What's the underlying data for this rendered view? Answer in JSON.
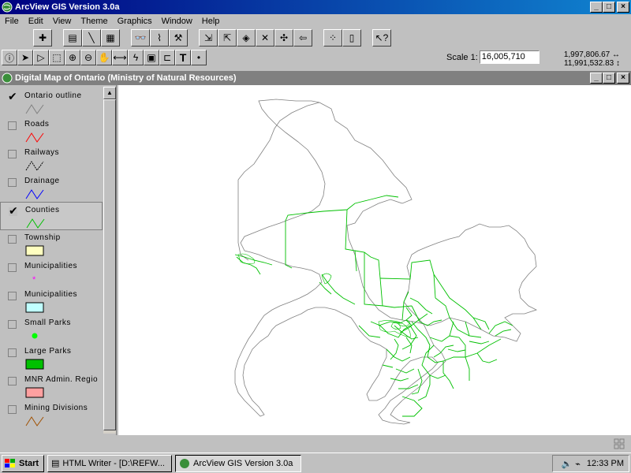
{
  "app": {
    "title": "ArcView GIS Version 3.0a"
  },
  "menu": [
    "File",
    "Edit",
    "View",
    "Theme",
    "Graphics",
    "Window",
    "Help"
  ],
  "toolbar": {
    "scale_label": "Scale 1:",
    "scale_value": "16,005,710",
    "coord_x": "1,997,806.67",
    "coord_y": "11,991,532.83"
  },
  "view": {
    "title": "Digital Map of Ontario (Ministry of Natural Resources)",
    "themes": [
      {
        "label": "Ontario outline",
        "checked": true,
        "legend": "line",
        "color": "#808080"
      },
      {
        "label": "Roads",
        "checked": false,
        "legend": "line",
        "color": "#ff0000"
      },
      {
        "label": "Railways",
        "checked": false,
        "legend": "rail",
        "color": "#000000"
      },
      {
        "label": "Drainage",
        "checked": false,
        "legend": "line",
        "color": "#0000ff"
      },
      {
        "label": "Counties",
        "checked": true,
        "legend": "line",
        "color": "#00c000"
      },
      {
        "label": "Township",
        "checked": false,
        "legend": "box",
        "color": "#ffffc0"
      },
      {
        "label": "Municipalities",
        "checked": false,
        "legend": "star",
        "color": "#ff00ff"
      },
      {
        "label": "Municipalities",
        "checked": false,
        "legend": "box",
        "color": "#c0ffff"
      },
      {
        "label": "Small Parks",
        "checked": false,
        "legend": "dot",
        "color": "#00ff00"
      },
      {
        "label": "Large Parks",
        "checked": false,
        "legend": "box",
        "color": "#00c000"
      },
      {
        "label": "MNR Admin. Regio",
        "checked": false,
        "legend": "box",
        "color": "#ffa0a0"
      },
      {
        "label": "Mining Divisions",
        "checked": false,
        "legend": "line",
        "color": "#a05000"
      }
    ]
  },
  "taskbar": {
    "start": "Start",
    "tasks": [
      "HTML Writer - [D:\\REFW...",
      "ArcView GIS Version 3.0a"
    ],
    "clock": "12:33 PM"
  }
}
